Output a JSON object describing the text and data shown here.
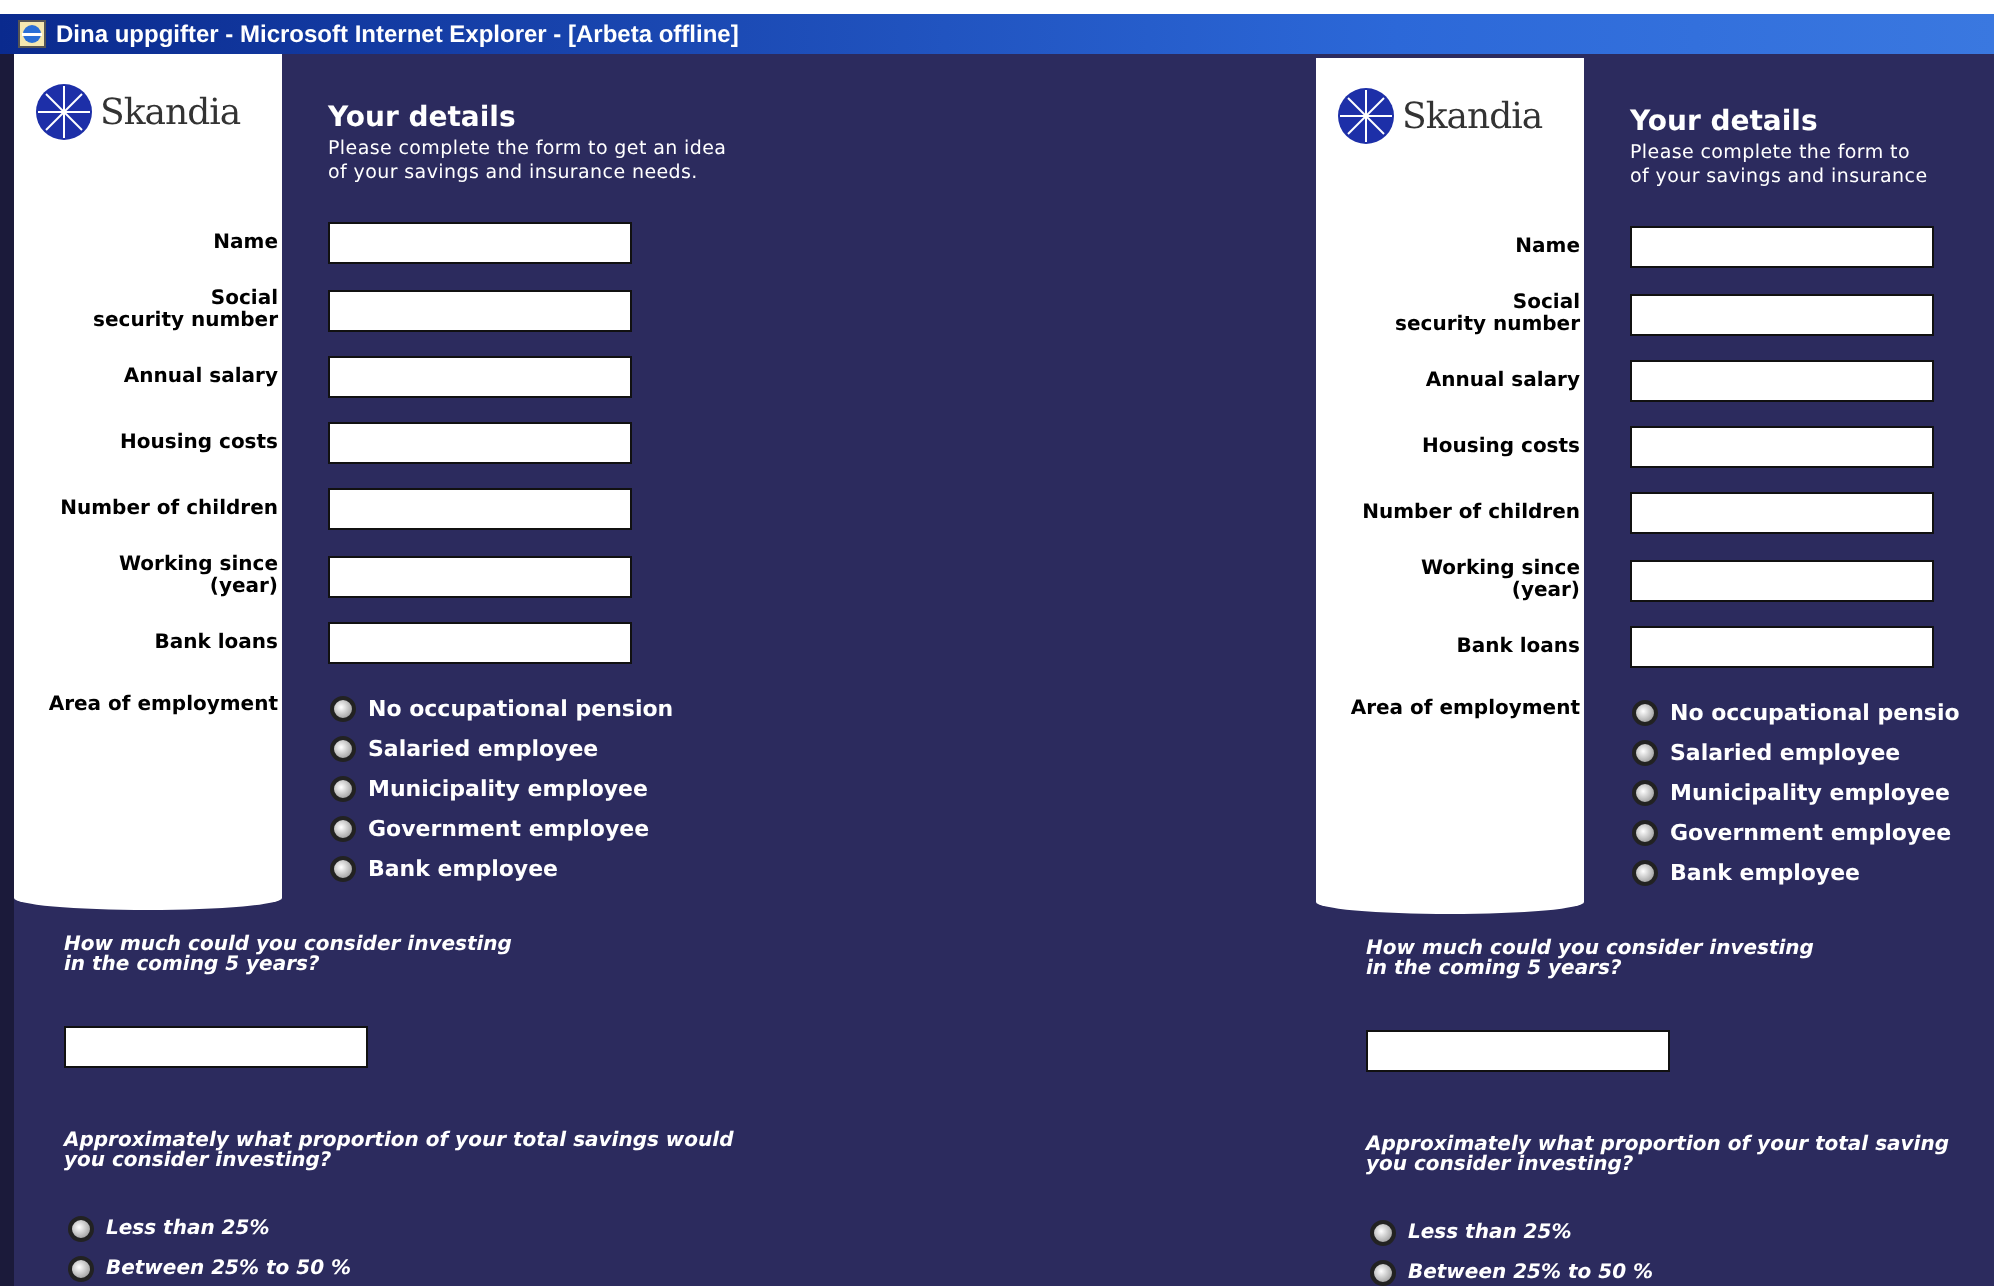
{
  "window": {
    "title": "Dina uppgifter - Microsoft Internet Explorer - [Arbeta offline]"
  },
  "panels": [
    {
      "logo": "Skandia",
      "heading": "Your details",
      "intro": [
        "Please complete the form to get an idea",
        "of your savings and insurance needs."
      ],
      "fields": [
        {
          "label": "Name"
        },
        {
          "label": "Social\nsecurity number"
        },
        {
          "label": "Annual salary"
        },
        {
          "label": "Housing costs"
        },
        {
          "label": "Number of children"
        },
        {
          "label": "Working since\n(year)"
        },
        {
          "label": "Bank loans"
        }
      ],
      "employment_label": "Area of employment",
      "employment_options": [
        {
          "label": "No occupational pension",
          "selected": false
        },
        {
          "label": "Salaried employee",
          "selected": false
        },
        {
          "label": "Municipality employee",
          "selected": false
        },
        {
          "label": "Government employee",
          "selected": false
        },
        {
          "label": "Bank employee",
          "selected": false
        }
      ],
      "question_1": [
        "How much could you consider investing",
        "in the coming 5 years?"
      ],
      "question_2": [
        "Approximately what proportion of your total savings would",
        "you consider investing?"
      ],
      "proportion_options": [
        {
          "label": "Less than 25%",
          "selected": false
        },
        {
          "label": "Between 25% to 50 %",
          "selected": false
        }
      ]
    },
    {
      "logo": "Skandia",
      "heading": "Your details",
      "intro": [
        "Please complete the form to",
        "of your savings and insurance"
      ],
      "fields": [
        {
          "label": "Name"
        },
        {
          "label": "Social\nsecurity number"
        },
        {
          "label": "Annual salary"
        },
        {
          "label": "Housing costs"
        },
        {
          "label": "Number of children"
        },
        {
          "label": "Working since\n(year)"
        },
        {
          "label": "Bank loans"
        }
      ],
      "employment_label": "Area of employment",
      "employment_options": [
        {
          "label": "No occupational pensio",
          "selected": false
        },
        {
          "label": "Salaried employee",
          "selected": false
        },
        {
          "label": "Municipality employee",
          "selected": false
        },
        {
          "label": "Government employee",
          "selected": false
        },
        {
          "label": "Bank employee",
          "selected": false
        }
      ],
      "question_1": [
        "How much could you consider investing",
        "in the coming 5 years?"
      ],
      "question_2": [
        "Approximately what proportion of your total saving",
        "you consider investing?"
      ],
      "proportion_options": [
        {
          "label": "Less than 25%",
          "selected": false
        },
        {
          "label": "Between 25% to 50 %",
          "selected": false
        }
      ]
    }
  ]
}
